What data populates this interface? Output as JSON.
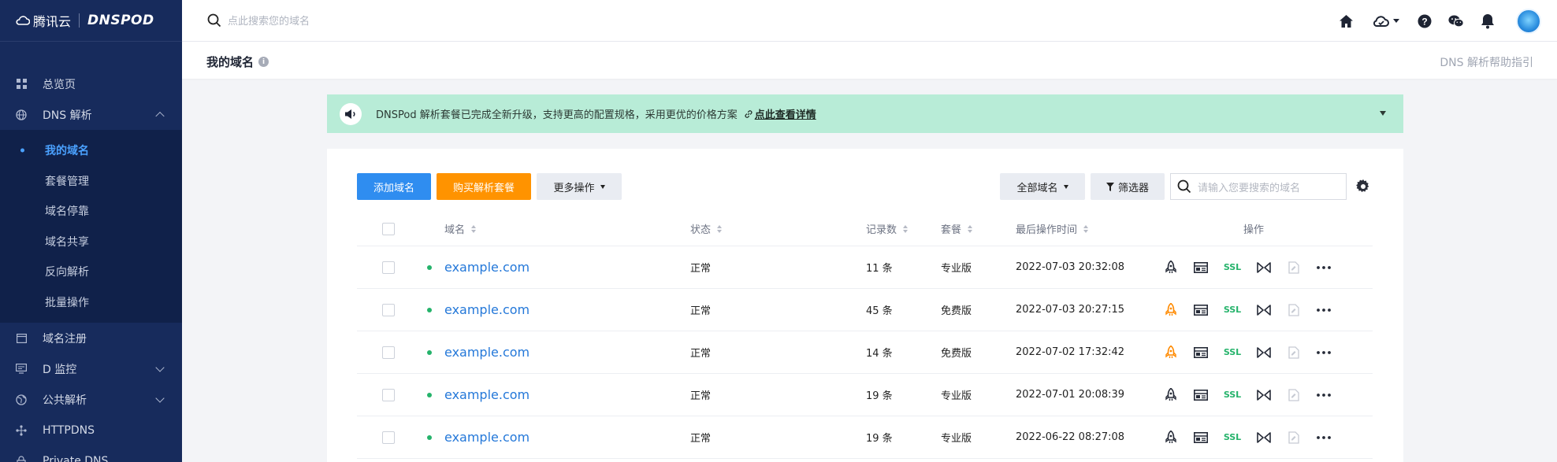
{
  "brand": {
    "name": "腾讯云",
    "product": "DNSPOD"
  },
  "sidebar": {
    "items": [
      {
        "label": "总览页",
        "icon": "grid-icon"
      },
      {
        "label": "DNS 解析",
        "icon": "globe-icon",
        "expanded": true
      }
    ],
    "sub_items": [
      {
        "label": "我的域名",
        "active": true
      },
      {
        "label": "套餐管理"
      },
      {
        "label": "域名停靠"
      },
      {
        "label": "域名共享"
      },
      {
        "label": "反向解析"
      },
      {
        "label": "批量操作"
      }
    ],
    "items_after": [
      {
        "label": "域名注册",
        "icon": "window-icon"
      },
      {
        "label": "D 监控",
        "icon": "monitor-icon"
      },
      {
        "label": "公共解析",
        "icon": "globe-icon"
      },
      {
        "label": "HTTPDNS",
        "icon": "network-icon"
      },
      {
        "label": "Private DNS",
        "icon": "lock-icon"
      }
    ]
  },
  "topbar": {
    "search_placeholder": "点此搜索您的域名",
    "icons": [
      "home-icon",
      "cloud-icon",
      "help-icon",
      "wechat-icon",
      "bell-icon",
      "avatar"
    ]
  },
  "page": {
    "title": "我的域名",
    "help_link": "DNS 解析帮助指引"
  },
  "notice": {
    "text": "DNSPod 解析套餐已完成全新升级，支持更高的配置规格，采用更优的价格方案",
    "link": "点此查看详情",
    "bg_color": "#b8ecd7"
  },
  "toolbar": {
    "add_domain": "添加域名",
    "buy_package": "购买解析套餐",
    "more_actions": "更多操作",
    "all_domains": "全部域名",
    "filter": "筛选器",
    "search_placeholder": "请输入您要搜索的域名"
  },
  "table": {
    "headers": {
      "domain": "域名",
      "status": "状态",
      "records": "记录数",
      "plan": "套餐",
      "last_op": "最后操作时间",
      "actions": "操作"
    },
    "rows": [
      {
        "domain": "example.com",
        "status": "正常",
        "records": "11 条",
        "plan": "专业版",
        "time": "2022-07-03 20:32:08",
        "rocket": "dark"
      },
      {
        "domain": "example.com",
        "status": "正常",
        "records": "45 条",
        "plan": "免费版",
        "time": "2022-07-03 20:27:15",
        "rocket": "orange"
      },
      {
        "domain": "example.com",
        "status": "正常",
        "records": "14 条",
        "plan": "免费版",
        "time": "2022-07-02 17:32:42",
        "rocket": "orange"
      },
      {
        "domain": "example.com",
        "status": "正常",
        "records": "19 条",
        "plan": "专业版",
        "time": "2022-07-01 20:08:39",
        "rocket": "dark"
      },
      {
        "domain": "example.com",
        "status": "正常",
        "records": "19 条",
        "plan": "专业版",
        "time": "2022-06-22 08:27:08",
        "rocket": "dark"
      }
    ],
    "ssl_label": "SSL"
  },
  "colors": {
    "sidebar_bg": "#172b5c",
    "primary": "#2f8df0",
    "warning": "#ff9300",
    "status_ok": "#25b36b",
    "link": "#2478d9"
  }
}
